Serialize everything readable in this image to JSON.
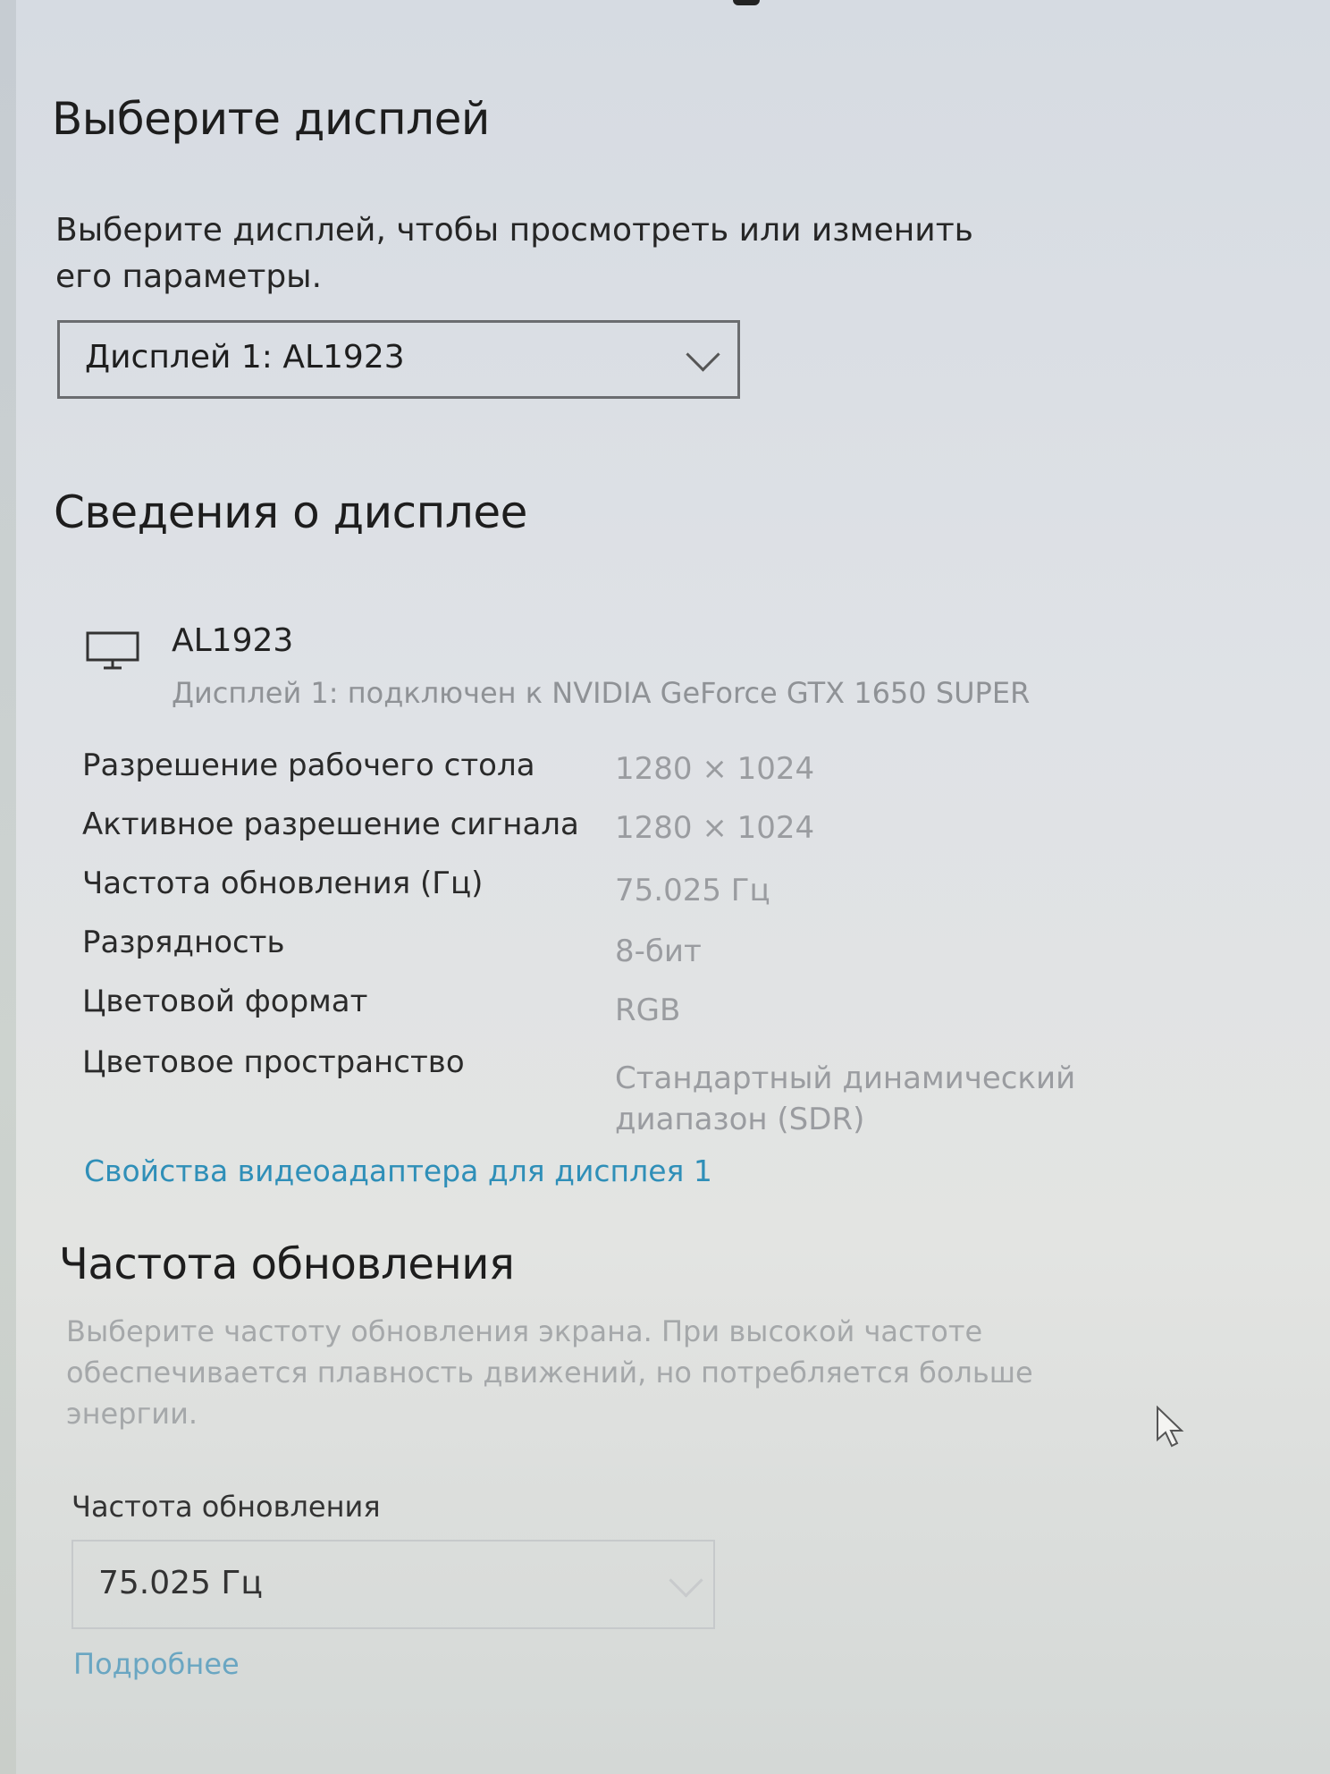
{
  "select_display": {
    "heading": "Выберите дисплей",
    "description": "Выберите дисплей, чтобы просмотреть или изменить его параметры.",
    "dropdown_value": "Дисплей 1: AL1923"
  },
  "display_info": {
    "heading": "Сведения о дисплее",
    "monitor_name": "AL1923",
    "connection": "Дисплей 1: подключен к NVIDIA GeForce GTX 1650 SUPER",
    "rows": [
      {
        "label": "Разрешение рабочего стола",
        "value": "1280 × 1024"
      },
      {
        "label": "Активное разрешение сигнала",
        "value": "1280 × 1024"
      },
      {
        "label": "Частота обновления (Гц)",
        "value": "75.025 Гц"
      },
      {
        "label": "Разрядность",
        "value": "8-бит"
      },
      {
        "label": "Цветовой формат",
        "value": "RGB"
      },
      {
        "label": "Цветовое пространство",
        "value": "Стандартный динамический",
        "value2": "диапазон (SDR)"
      }
    ],
    "adapter_link": "Свойства видеоадаптера для дисплея 1"
  },
  "refresh_rate": {
    "heading": "Частота обновления",
    "description": "Выберите частоту обновления экрана. При высокой частоте обеспечивается плавность движений, но потребляется больше энергии.",
    "field_label": "Частота обновления",
    "dropdown_value": "75.025 Гц",
    "more_link": "Подробнее"
  },
  "icons": {
    "monitor": "monitor-icon",
    "chevron": "chevron-down-icon",
    "cursor": "mouse-pointer-icon"
  },
  "colors": {
    "link": "#2f8fb8",
    "muted": "#9a9ca0"
  }
}
